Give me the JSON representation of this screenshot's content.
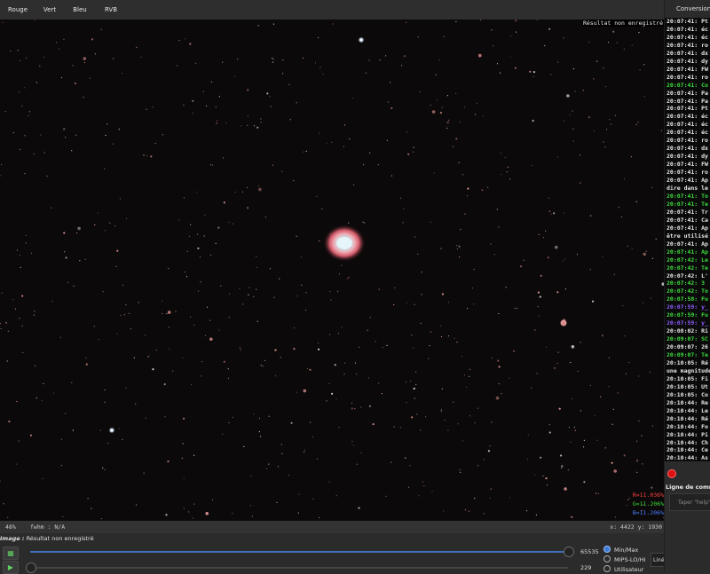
{
  "tabs": [
    "Rouge",
    "Vert",
    "Bleu",
    "RVB"
  ],
  "active_tab": "RVB",
  "viewer": {
    "unsaved_label": "Résultat non enregistré",
    "pct_r": "R=11.036%",
    "pct_g": "G=11.206%",
    "pct_b": "B=11.206%",
    "pct_colors": {
      "r": "#ff4040",
      "g": "#3ddc3d",
      "b": "#4a7dff"
    }
  },
  "status": {
    "zoom": "48%",
    "fwhm": "fwhm : N/A",
    "coords": "x: 4422 y: 1930"
  },
  "image_title": {
    "prefix": "Image :",
    "text": " Résultat non enregistré"
  },
  "sliders": {
    "top_value": "65535",
    "bottom_value": "229"
  },
  "radios": [
    {
      "label": "Min/Max",
      "checked": true
    },
    {
      "label": "MIPS-LO/HI",
      "checked": false
    },
    {
      "label": "Utilisateur",
      "checked": false
    }
  ],
  "stretch_select": "Linéaire",
  "right_panel": {
    "title": "Conversion",
    "cmd_label": "Ligne de commande",
    "cmd_placeholder": "Taper \"help\"",
    "log": [
      {
        "t": "20:07:41: Pt",
        "c": "#e8e8e8"
      },
      {
        "t": "20:07:41: éc",
        "c": "#e8e8e8"
      },
      {
        "t": "20:07:41: éc",
        "c": "#e8e8e8"
      },
      {
        "t": "20:07:41: ro",
        "c": "#e8e8e8"
      },
      {
        "t": "20:07:41: dx",
        "c": "#e8e8e8"
      },
      {
        "t": "20:07:41: dy",
        "c": "#e8e8e8"
      },
      {
        "t": "20:07:41: FW",
        "c": "#e8e8e8"
      },
      {
        "t": "20:07:41: ro",
        "c": "#e8e8e8"
      },
      {
        "t": "20:07:41: Co",
        "c": "#3ddc3d"
      },
      {
        "t": "20:07:41: Pa",
        "c": "#e8e8e8"
      },
      {
        "t": "20:07:41: Pa",
        "c": "#e8e8e8"
      },
      {
        "t": "20:07:41: Pt",
        "c": "#e8e8e8"
      },
      {
        "t": "20:07:41: éc",
        "c": "#e8e8e8"
      },
      {
        "t": "20:07:41: éc",
        "c": "#e8e8e8"
      },
      {
        "t": "20:07:41: éc",
        "c": "#e8e8e8"
      },
      {
        "t": "20:07:41: ro",
        "c": "#e8e8e8"
      },
      {
        "t": "20:07:41: dx",
        "c": "#e8e8e8"
      },
      {
        "t": "20:07:41: dy",
        "c": "#e8e8e8"
      },
      {
        "t": "20:07:41: FW",
        "c": "#e8e8e8"
      },
      {
        "t": "20:07:41: ro",
        "c": "#e8e8e8"
      },
      {
        "t": "20:07:41: Ap",
        "c": "#e8e8e8"
      },
      {
        "t": "dire dans le",
        "c": "#e8e8e8"
      },
      {
        "t": "20:07:41: To",
        "c": "#3ddc3d"
      },
      {
        "t": "20:07:41: Te",
        "c": "#3ddc3d"
      },
      {
        "t": "20:07:41: Tr",
        "c": "#e8e8e8"
      },
      {
        "t": "20:07:41: Ca",
        "c": "#e8e8e8"
      },
      {
        "t": "20:07:41: Ap",
        "c": "#e8e8e8"
      },
      {
        "t": "être utilisé",
        "c": "#e8e8e8"
      },
      {
        "t": "20:07:41: Ap",
        "c": "#e8e8e8"
      },
      {
        "t": "20:07:41: Ap",
        "c": "#3ddc3d"
      },
      {
        "t": "20:07:42: Le",
        "c": "#3ddc3d"
      },
      {
        "t": "20:07:42: Te",
        "c": "#3ddc3d"
      },
      {
        "t": "20:07:42: L'",
        "c": "#e8e8e8"
      },
      {
        "t": "20:07:42: 3",
        "c": "#3ddc3d"
      },
      {
        "t": "20:07:42: To",
        "c": "#3ddc3d"
      },
      {
        "t": "20:07:58: Fu",
        "c": "#3ddc3d"
      },
      {
        "t": "20:07:59: y_",
        "c": "#8a5cf6"
      },
      {
        "t": "20:07:59: Fu",
        "c": "#3ddc3d"
      },
      {
        "t": "20:07:59: y_",
        "c": "#8a5cf6"
      },
      {
        "t": "20:08:02: Ri",
        "c": "#e8e8e8"
      },
      {
        "t": "20:09:07: SC",
        "c": "#3ddc3d"
      },
      {
        "t": "20:09:07: 26",
        "c": "#e8e8e8"
      },
      {
        "t": "20:09:07: Te",
        "c": "#3ddc3d"
      },
      {
        "t": "20:10:05: Ré",
        "c": "#e8e8e8"
      },
      {
        "t": "une magnitude",
        "c": "#e8e8e8"
      },
      {
        "t": "20:10:05: Fi",
        "c": "#e8e8e8"
      },
      {
        "t": "20:10:05: Ut",
        "c": "#e8e8e8"
      },
      {
        "t": "20:10:05: Co",
        "c": "#e8e8e8"
      },
      {
        "t": "20:10:44: Re",
        "c": "#e8e8e8"
      },
      {
        "t": "20:10:44: Le",
        "c": "#e8e8e8"
      },
      {
        "t": "20:10:44: Ré",
        "c": "#e8e8e8"
      },
      {
        "t": "20:10:44: Fo",
        "c": "#e8e8e8"
      },
      {
        "t": "20:10:44: Pi",
        "c": "#e8e8e8"
      },
      {
        "t": "20:10:44: Ch",
        "c": "#e8e8e8"
      },
      {
        "t": "20:10:44: Ce",
        "c": "#e8e8e8"
      },
      {
        "t": "20:10:44: As",
        "c": "#e8e8e8"
      }
    ]
  }
}
